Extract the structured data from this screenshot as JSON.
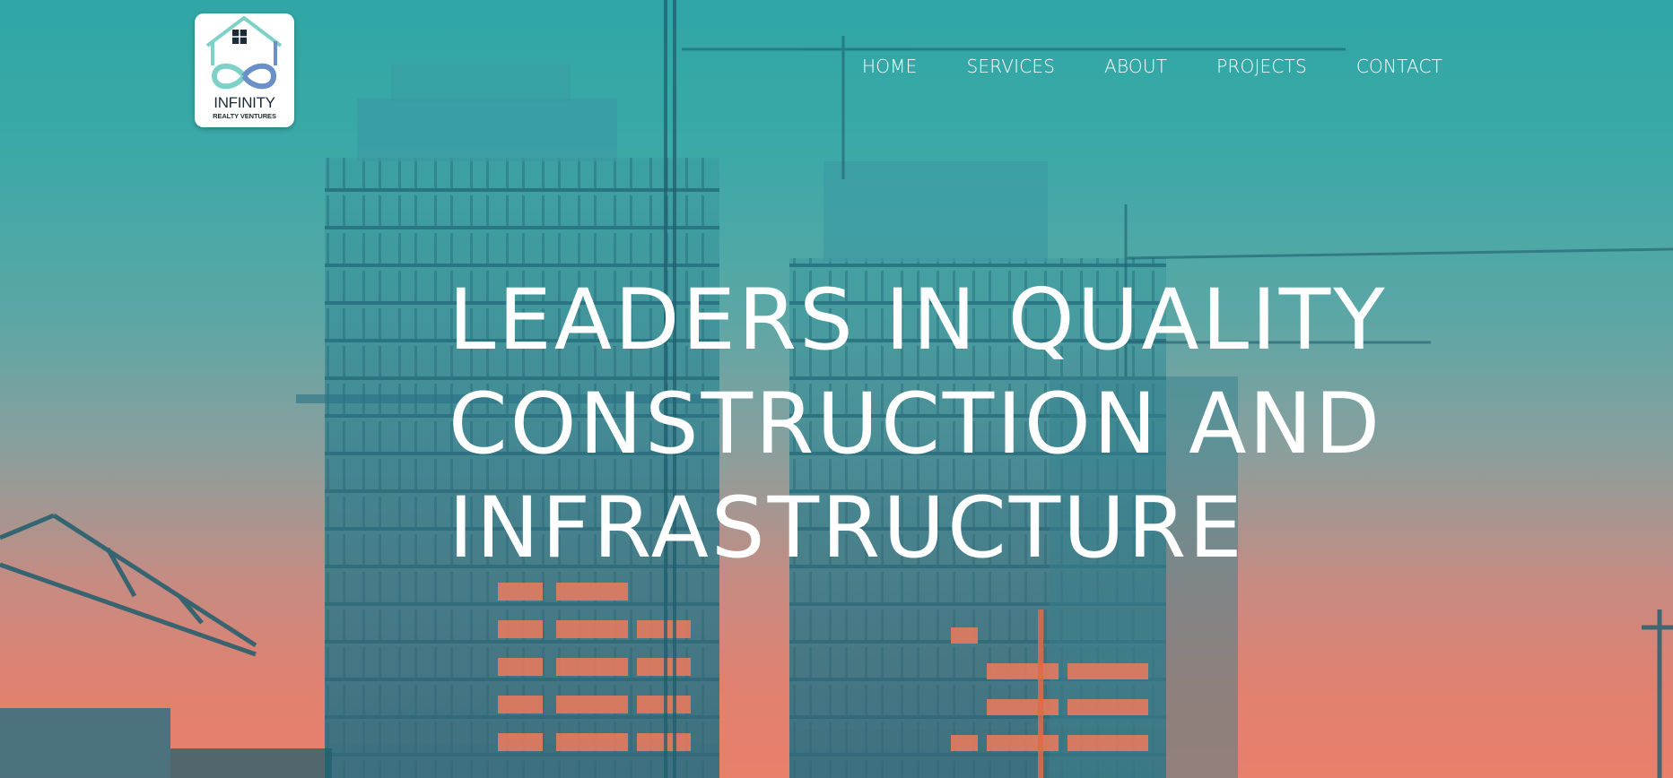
{
  "brand": {
    "name": "INFINITY",
    "tagline": "REALTY VENTURES",
    "colors": {
      "teal": "#7fd1c8",
      "blue": "#6b8fc9",
      "dark": "#1d2b38"
    }
  },
  "nav": {
    "items": [
      {
        "label": "HOME"
      },
      {
        "label": "SERVICES"
      },
      {
        "label": "ABOUT"
      },
      {
        "label": "PROJECTS"
      },
      {
        "label": "CONTACT"
      }
    ]
  },
  "hero": {
    "headline_lines": [
      "LEADERS IN QUALITY",
      "CONSTRUCTION AND",
      "INFRASTRUCTURE"
    ],
    "colors": {
      "sky_top": "#2fa6a6",
      "sky_bottom": "#e8806b",
      "building": "#2c7f8f",
      "window_glow": "#f07a5a"
    }
  }
}
